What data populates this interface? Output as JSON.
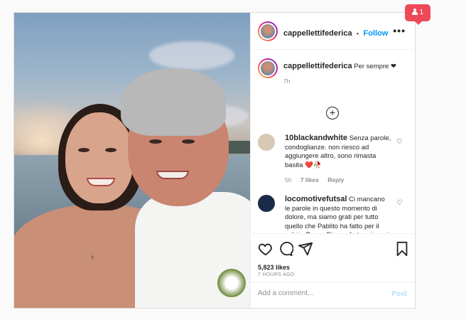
{
  "post": {
    "username": "cappellettifederica",
    "separator": "•",
    "follow_label": "Follow",
    "more_icon": "more-options-icon",
    "caption": {
      "username": "cappellettifederica",
      "text": "Per sempre ❤",
      "time": "7h"
    },
    "load_more_icon": "plus-circle-icon",
    "comments": [
      {
        "username": "10blackandwhite",
        "text": "Senza parole, condoglianze. non riesco ad aggiungere altro, sono rimasta basita ❤️🥀",
        "time": "5h",
        "likes": "7 likes",
        "reply_label": "Reply"
      },
      {
        "username": "locomotivefutsal",
        "text": "Ci mancano le parole in questo momento di dolore, ma siamo grati per tutto quello che Pablito ha fatto per il calcio. Possa Dio confortare i cuori di tutti coloro che sono stati"
      }
    ],
    "likes_count": "5,823 likes",
    "timestamp": "7 HOURS AGO",
    "comment_placeholder": "Add a comment...",
    "post_label": "Post"
  },
  "notification": {
    "count": "1",
    "icon": "person-icon",
    "color": "#ed4956"
  },
  "colors": {
    "accent": "#0095f6",
    "post_disabled": "#b2dffc",
    "border": "#dbdbdb"
  }
}
